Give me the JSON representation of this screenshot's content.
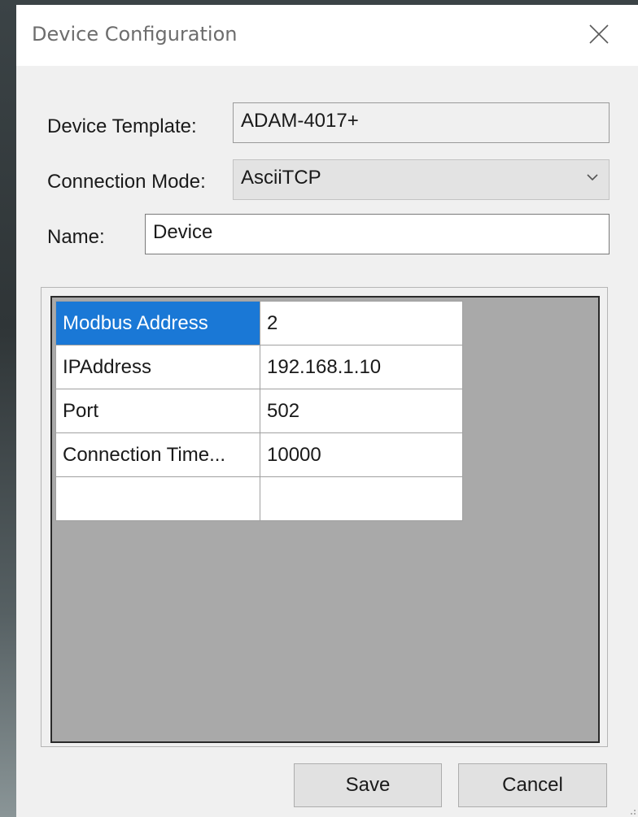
{
  "window": {
    "title": "Device Configuration"
  },
  "form": {
    "device_template": {
      "label": "Device Template:",
      "value": "ADAM-4017+"
    },
    "connection_mode": {
      "label": "Connection Mode:",
      "value": "AsciiTCP"
    },
    "name": {
      "label": "Name:",
      "value": "Device"
    }
  },
  "grid": {
    "rows": [
      {
        "property": "Modbus Address",
        "value": "2"
      },
      {
        "property": "IPAddress",
        "value": "192.168.1.10"
      },
      {
        "property": "Port",
        "value": "502"
      },
      {
        "property": "Connection Time...",
        "value": "10000"
      },
      {
        "property": "",
        "value": ""
      }
    ],
    "selected_row": 0,
    "selection_color": "#1a78d6"
  },
  "buttons": {
    "save": "Save",
    "cancel": "Cancel"
  },
  "icons": {
    "close": "close-icon",
    "dropdown": "chevron-down-icon",
    "resize": "resize-grip-icon"
  }
}
